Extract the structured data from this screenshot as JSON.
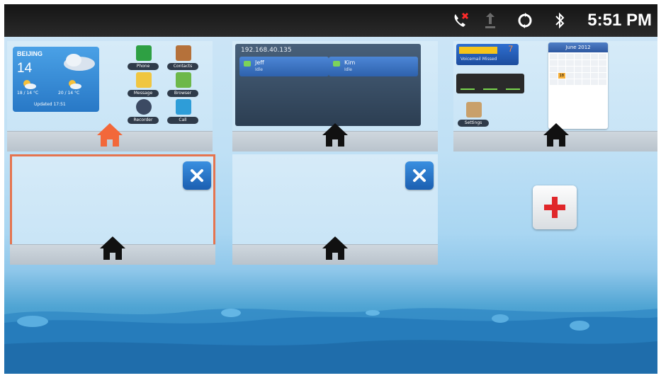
{
  "status_bar": {
    "time": "5:51 PM",
    "icons": [
      "missed-call-icon",
      "upload-icon",
      "sync-icon",
      "bluetooth-icon"
    ]
  },
  "panels": [
    {
      "id": "home-1",
      "active_home": true,
      "weather": {
        "city": "BEIJING",
        "temp": "14",
        "forecast_1": "18 / 14 °C",
        "forecast_2": "20 / 14 °C",
        "updated": "Updated 17:51"
      },
      "apps": [
        "Phone",
        "Contacts",
        "Message",
        "Browser",
        "Recorder",
        "Call"
      ]
    },
    {
      "id": "home-2",
      "calls_title": "192.168.40.135",
      "lines": [
        {
          "name": "Jeff",
          "status": "Idle"
        },
        {
          "name": "Kim",
          "status": "Idle"
        }
      ]
    },
    {
      "id": "home-3",
      "voicemail": {
        "count": "7",
        "label": "Voicemail Missed"
      },
      "calendar": {
        "month": "June 2012",
        "today": "18"
      },
      "apps": [
        "Settings"
      ]
    },
    {
      "id": "home-4",
      "selected": true,
      "removable": true
    },
    {
      "id": "home-5",
      "removable": true
    },
    {
      "id": "add-home"
    }
  ],
  "colors": {
    "active_home": "#f2683a",
    "home": "#111111",
    "close_button": "#2a74c9",
    "add_plus": "#e0262a",
    "selected_border": "#e5744f"
  }
}
